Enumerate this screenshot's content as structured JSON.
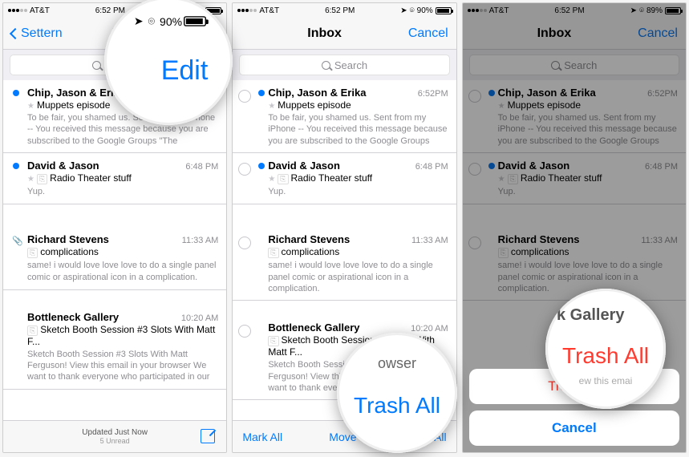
{
  "status": {
    "carrier": "AT&T",
    "time": "6:52 PM",
    "battery_percent": "90%",
    "battery_percent_p3": "89%"
  },
  "nav": {
    "back_label": "Settern",
    "title": "Inbox",
    "edit": "Edit",
    "cancel": "Cancel"
  },
  "search": {
    "placeholder": "Search"
  },
  "emails": [
    {
      "from": "Chip, Jason & Erika",
      "time": "6:52PM",
      "subject": "Muppets episode",
      "preview": "To be fair, you shamed us. Sent from my iPhone -- You received this message because you are subscribed to the Google Groups \"The Incomparable Podcast\" group. To unsubscribe...",
      "preview_p2": "To be fair, you shamed us. Sent from my iPhone -- You received this message because you are subscribed to the Google Groups \"The Incomparable Podcast\" grou...",
      "unread": true,
      "star": true
    },
    {
      "from": "David & Jason",
      "time": "6:48 PM",
      "subject": "Radio Theater stuff",
      "preview": "Yup.",
      "unread": true,
      "star": true,
      "tag": true
    },
    {
      "from": "Richard Stevens",
      "time": "11:33 AM",
      "subject": "complications",
      "preview": "same! i would love love love to do a single panel comic or aspirational icon in a complication.",
      "unread": false,
      "clip": true,
      "tag": true
    },
    {
      "from": "Bottleneck Gallery",
      "time": "10:20 AM",
      "subject": "Sketch Booth Session #3 Slots With Matt F...",
      "preview": "Sketch Booth Session #3 Slots With Matt Ferguson! View this email in your browser We want to thank everyone who participated in our",
      "unread": false,
      "tag": true
    }
  ],
  "toolbar": {
    "updated": "Updated Just Now",
    "unread": "5 Unread",
    "mark_all": "Mark All",
    "move": "Move",
    "trash_all": "Trash All"
  },
  "sheet": {
    "trash_all": "Trash All",
    "cancel": "Cancel"
  },
  "lens": {
    "edit": "Edit",
    "trash_all_blue": "Trash All",
    "trash_all_red": "Trash All",
    "browser_frag": "owser",
    "gallery_frag": "k Gallery",
    "email_frag": "ew this emai"
  }
}
